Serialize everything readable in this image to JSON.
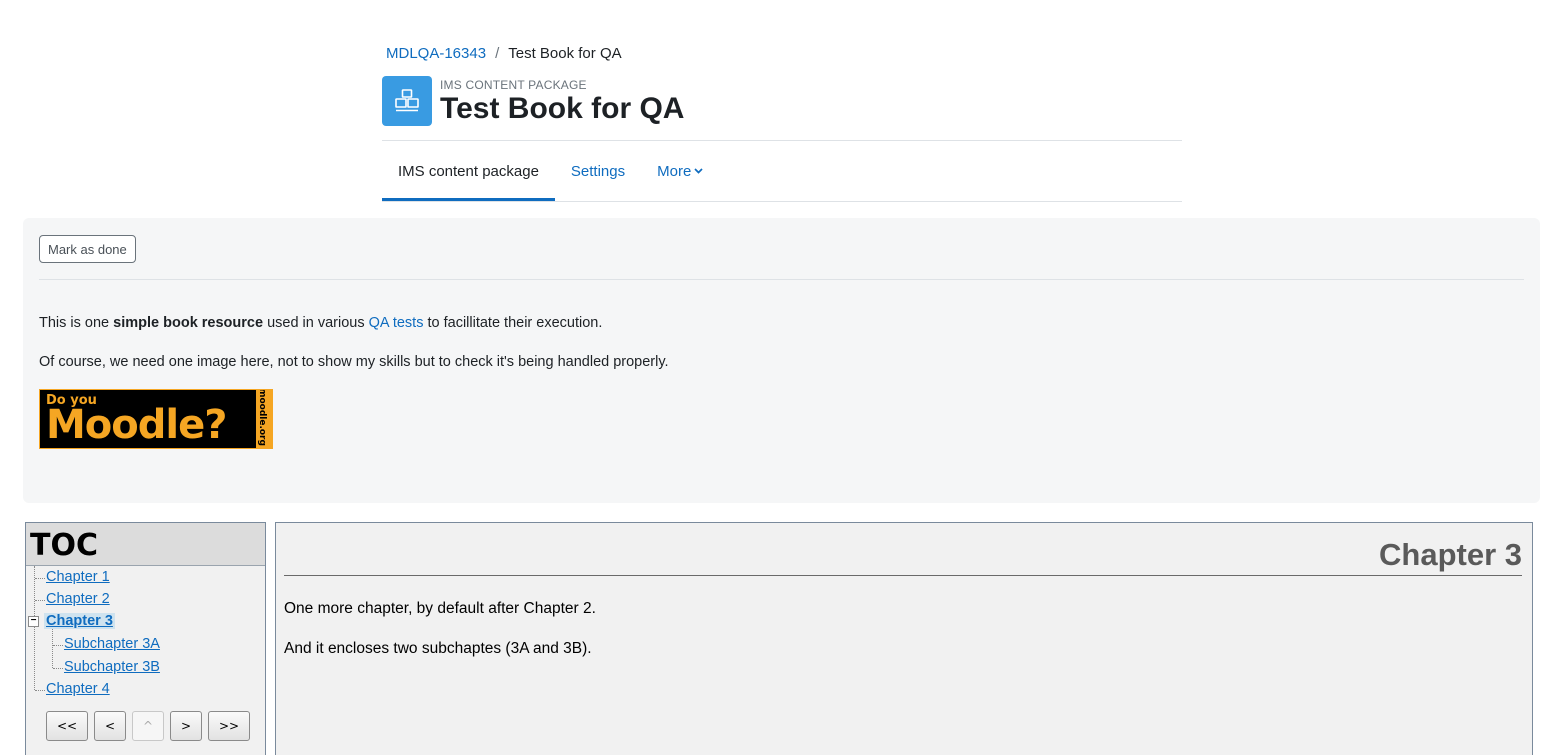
{
  "breadcrumb": {
    "course_link": "MDLQA-16343",
    "separator": "/",
    "current": "Test Book for QA"
  },
  "header": {
    "icon": "package-icon",
    "purpose": "IMS CONTENT PACKAGE",
    "title": "Test Book for QA"
  },
  "tabs": [
    {
      "label": "IMS content package",
      "active": true
    },
    {
      "label": "Settings",
      "active": false
    },
    {
      "label": "More",
      "active": false
    }
  ],
  "intro": {
    "mark_done_label": "Mark as done",
    "p1_before": "This is one ",
    "p1_bold": "simple book resource",
    "p1_middle": " used in various ",
    "p1_link": "QA tests",
    "p1_after": " to facillitate their execution.",
    "p2": "Of course, we need one image here, not to show my skills but to check it's being handled properly.",
    "badge": {
      "line1": "Do you",
      "line2": "Moodle?",
      "side": "moodle.org"
    }
  },
  "toc": {
    "heading": "TOC",
    "items": [
      {
        "label": "Chapter 1",
        "level": 0
      },
      {
        "label": "Chapter 2",
        "level": 0
      },
      {
        "label": "Chapter 3",
        "level": 0,
        "selected": true,
        "toggle": "−"
      },
      {
        "label": "Subchapter 3A",
        "level": 1
      },
      {
        "label": "Subchapter 3B",
        "level": 1
      },
      {
        "label": "Chapter 4",
        "level": 0
      }
    ],
    "nav": {
      "first": "<<",
      "prev": "<",
      "up": "^",
      "next": ">",
      "last": ">>"
    }
  },
  "content": {
    "chapter_title": "Chapter 3",
    "p1": "One more chapter, by default after Chapter 2.",
    "p2": "And it encloses two subchaptes (3A and 3B)."
  },
  "colors": {
    "link": "#0f6cbf",
    "icon_bg": "#399be2",
    "badge_orange": "#f5a623"
  }
}
